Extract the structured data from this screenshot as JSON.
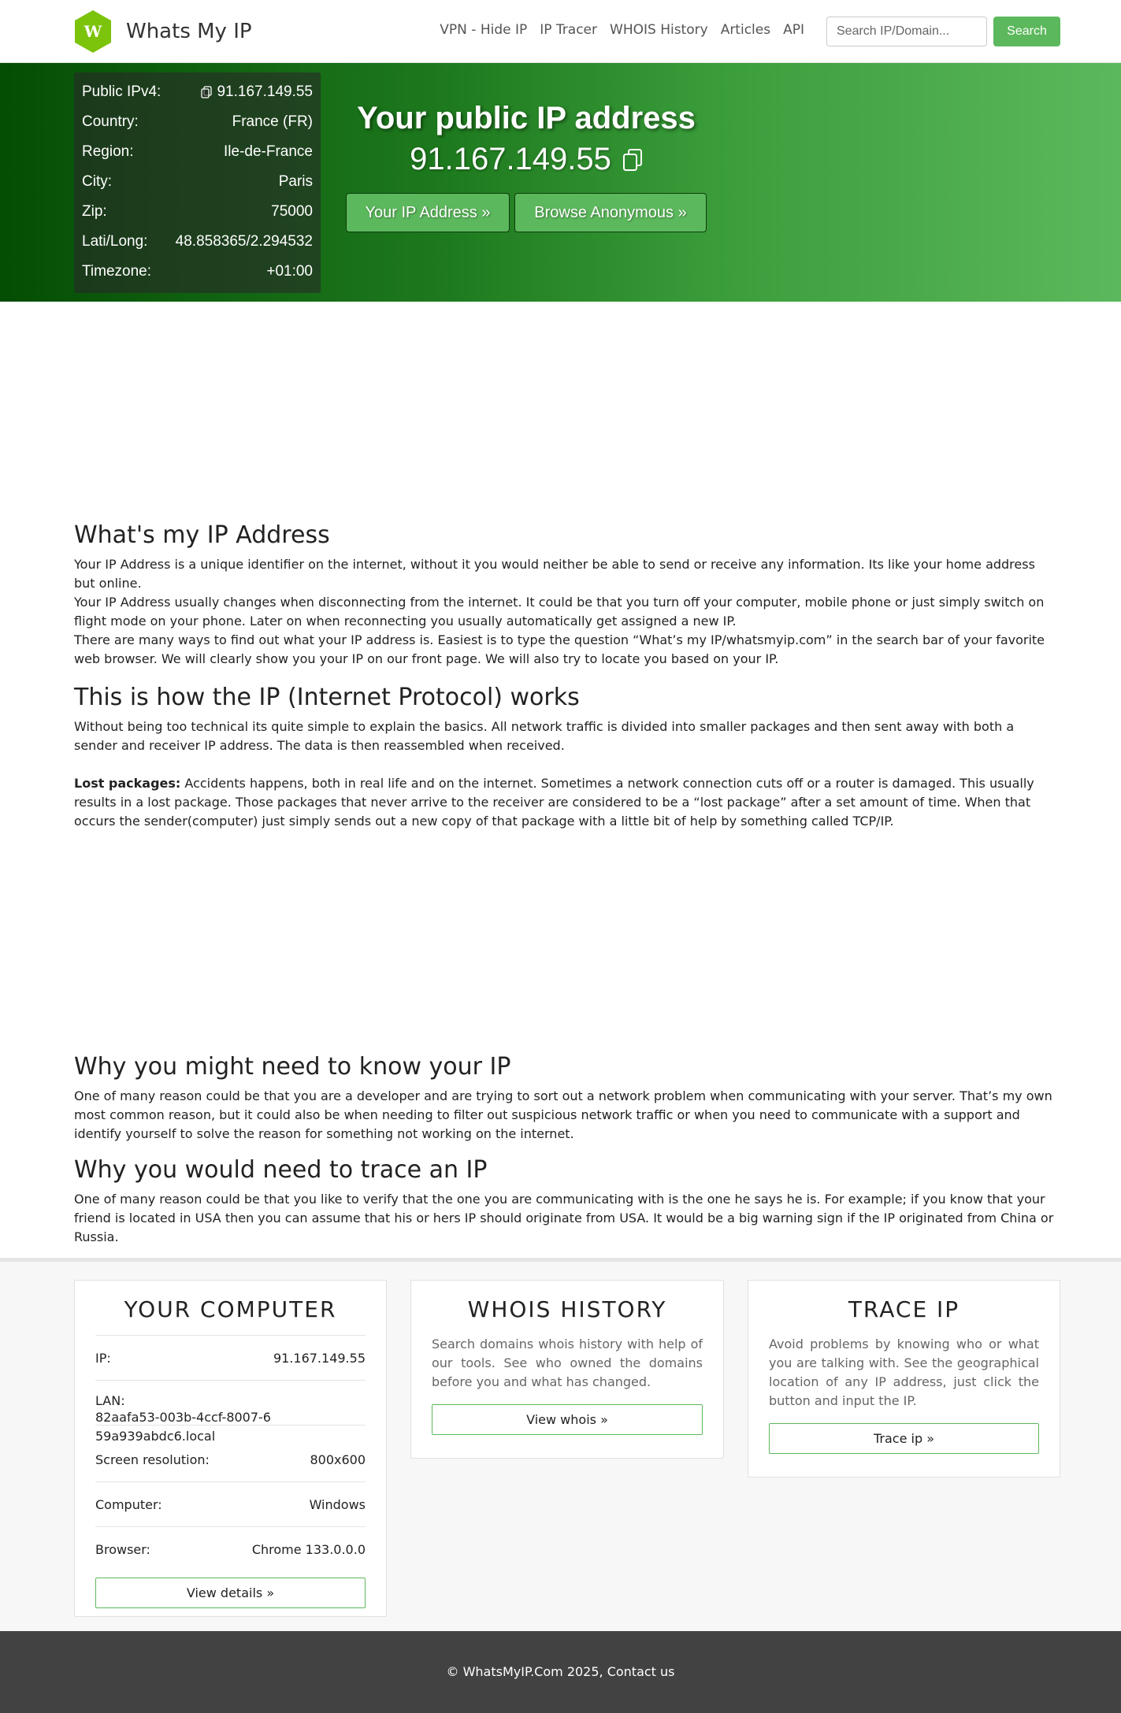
{
  "brand": {
    "logo_letter": "W",
    "name": "Whats My IP",
    "logo_color": "#7cc30c"
  },
  "nav": {
    "links": [
      "VPN - Hide IP",
      "IP Tracer",
      "WHOIS History",
      "Articles",
      "API"
    ],
    "search_placeholder": "Search IP/Domain...",
    "search_button": "Search"
  },
  "hero": {
    "info": [
      {
        "label": "Public IPv4:",
        "value": "91.167.149.55"
      },
      {
        "label": "Country:",
        "value": "France (FR)"
      },
      {
        "label": "Region:",
        "value": "Ile-de-France"
      },
      {
        "label": "City:",
        "value": "Paris"
      },
      {
        "label": "Zip:",
        "value": "75000"
      },
      {
        "label": "Lati/Long:",
        "value": "48.858365/2.294532"
      },
      {
        "label": "Timezone:",
        "value": "+01:00"
      }
    ],
    "title": "Your public IP address",
    "ip": "91.167.149.55",
    "btn_ip": "Your IP Address »",
    "btn_anon": "Browse Anonymous »"
  },
  "content": {
    "sec1": {
      "title": "What's my IP Address",
      "p1": "Your IP Address is a unique identifier on the internet, without it you would neither be able to send or receive any information. Its like your home address but online.",
      "p2": "Your IP Address usually changes when disconnecting from the internet. It could be that you turn off your computer, mobile phone or just simply switch on flight mode on your phone. Later on when reconnecting you usually automatically get assigned a new IP.",
      "p3": "There are many ways to find out what your IP address is. Easiest is to type the question “What’s my IP/whatsmyip.com” in the search bar of your favorite web browser. We will clearly show you your IP on our front page. We will also try to locate you based on your IP."
    },
    "sec2": {
      "title": "This is how the IP (Internet Protocol) works",
      "p1": "Without being too technical its quite simple to explain the basics. All network traffic is divided into smaller packages and then sent away with both a sender and receiver IP address. The data is then reassembled when received.",
      "lost_label": "Lost packages:",
      "p2": "Accidents happens, both in real life and on the internet. Sometimes a network connection cuts off or a router is damaged. This usually results in a lost package. Those packages that never arrive to the receiver are considered to be a “lost package” after a set amount of time. When that occurs the sender(computer) just simply sends out a new copy of that package with a little bit of help by something called TCP/IP."
    },
    "sec3": {
      "title": "Why you might need to know your IP",
      "p1": "One of many reason could be that you are a developer and are trying to sort out a network problem when communicating with your server. That’s my own most common reason, but it could also be when needing to filter out suspicious network traffic or when you need to communicate with a support and identify yourself to solve the reason for something not working on the internet."
    },
    "sec4": {
      "title": "Why you would need to trace an IP",
      "p1": "One of many reason could be that you like to verify that the one you are communicating with is the one he says he is. For example; if you know that your friend is located in USA then you can assume that his or hers IP should originate from USA. It would be a big warning sign if the IP originated from China or Russia."
    }
  },
  "cards": {
    "computer": {
      "title": "YOUR COMPUTER",
      "ip_label": "IP:",
      "ip_value": "91.167.149.55",
      "lan_label": "LAN:",
      "lan_value": "82aafa53-003b-4ccf-8007-659a939abdc6.local",
      "screen_label": "Screen resolution:",
      "screen_value": "800x600",
      "computer_label": "Computer:",
      "computer_value": "Windows",
      "browser_label": "Browser:",
      "browser_value": "Chrome 133.0.0.0",
      "button": "View details »"
    },
    "whois": {
      "title": "WHOIS HISTORY",
      "text": "Search domains whois history with help of our tools. See who owned the domains before you and what has changed.",
      "button": "View whois »"
    },
    "trace": {
      "title": "TRACE IP",
      "text": "Avoid problems by knowing who or what you are talking with. See the geographical location of any IP address, just click the button and input the IP.",
      "button": "Trace ip »"
    }
  },
  "footer": {
    "text": "© WhatsMyIP.Com 2025, Contact us"
  },
  "colors": {
    "accent": "#5cb85c",
    "hero_dark": "#044d04",
    "footer": "#424242"
  }
}
